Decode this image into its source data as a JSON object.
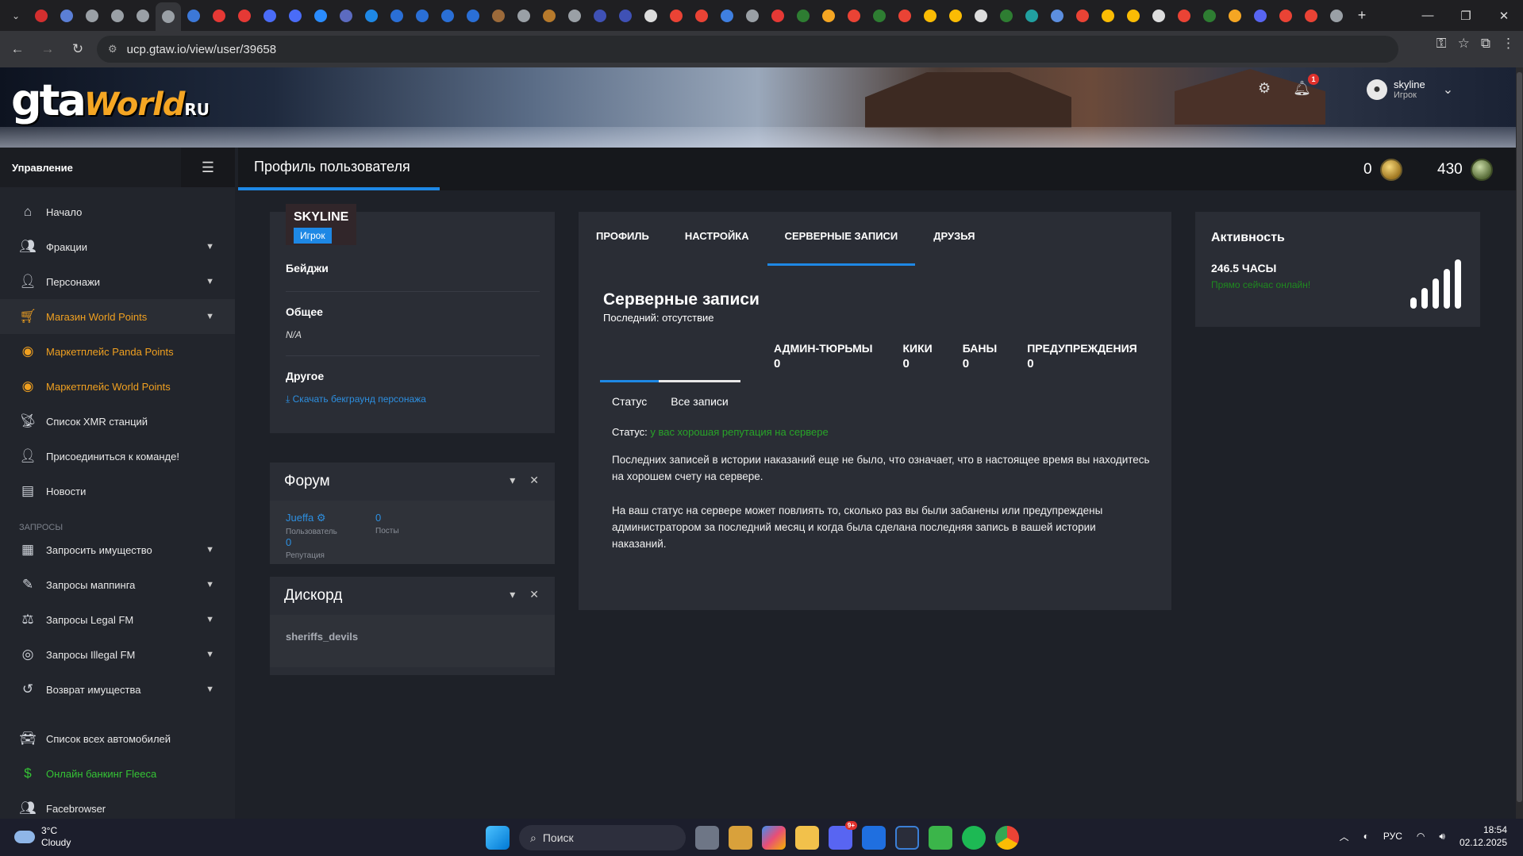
{
  "browser": {
    "url": "ucp.gtaw.io/view/user/39658",
    "tab_colors": [
      "#d32f2f",
      "#5b7fd6",
      "#9aa0a6",
      "#9aa0a6",
      "#9aa0a6",
      "#9aa0a6",
      "#3c78d8",
      "#e53935",
      "#e53935",
      "#4a6cf7",
      "#4a6cf7",
      "#2a8cff",
      "#5c6bc0",
      "#1e88e5",
      "#2a6fd6",
      "#2a6fd6",
      "#2a6fd6",
      "#2a6fd6",
      "#9c6a3a",
      "#9aa0a6",
      "#b77a2c",
      "#9aa0a6",
      "#3f51b5",
      "#3f51b5",
      "#ddd",
      "#ea4335",
      "#ea4335",
      "#3f7fe0",
      "#9aa0a6",
      "#e53935",
      "#2e7d32",
      "#f5a623",
      "#ea4335",
      "#2e7d32",
      "#ea4335",
      "#fbbc04",
      "#fbbc04",
      "#ddd",
      "#2e7d32",
      "#21a0a0",
      "#5c8fe0",
      "#ea4335",
      "#fbbc04",
      "#fbbc04",
      "#ddd",
      "#ea4335",
      "#2e7d32",
      "#f5a623",
      "#5865f2",
      "#ea4335",
      "#ea4335",
      "#9aa0a6"
    ]
  },
  "header": {
    "logo_main": "gta",
    "logo_script": "World",
    "logo_suffix": "RU",
    "notification_count": "1",
    "user_name": "skyline",
    "user_role": "Игрок"
  },
  "sidebar": {
    "title": "Управление",
    "items": [
      {
        "label": "Начало",
        "icon": "home-icon"
      },
      {
        "label": "Фракции",
        "icon": "group-icon"
      },
      {
        "label": "Персонажи",
        "icon": "person-icon"
      },
      {
        "label": "Магазин World Points",
        "icon": "cart-icon"
      },
      {
        "label": "Маркетплейс Panda Points",
        "icon": "coins-icon"
      },
      {
        "label": "Маркетплейс World Points",
        "icon": "coins-icon"
      },
      {
        "label": "Список XMR станций",
        "icon": "antenna-icon"
      },
      {
        "label": "Присоединиться к команде!",
        "icon": "person-icon"
      },
      {
        "label": "Новости",
        "icon": "newspaper-icon"
      }
    ],
    "section_requests": "Запросы",
    "request_items": [
      {
        "label": "Запросить имущество",
        "icon": "building-icon"
      },
      {
        "label": "Запросы маппинга",
        "icon": "brush-icon"
      },
      {
        "label": "Запросы Legal FM",
        "icon": "scales-icon"
      },
      {
        "label": "Запросы Illegal FM",
        "icon": "mask-icon"
      },
      {
        "label": "Возврат имущества",
        "icon": "undo-icon"
      }
    ],
    "bottom_items": [
      {
        "label": "Список всех автомобилей",
        "icon": "car-icon"
      },
      {
        "label": "Онлайн банкинг Fleeca",
        "icon": "money-icon"
      },
      {
        "label": "Facebrowser",
        "icon": "users-icon"
      }
    ]
  },
  "page": {
    "title": "Профиль пользователя",
    "currency_left": "0",
    "currency_right": "430"
  },
  "profile": {
    "name": "SKYLINE",
    "role": "Игрок",
    "badges_title": "Бейджи",
    "general_title": "Общее",
    "general_value": "N/A",
    "other_title": "Другое",
    "download_link": "Скачать бекграунд персонажа"
  },
  "forum": {
    "title": "Форум",
    "user": "Jueffa",
    "user_label": "Пользователь",
    "posts": "0",
    "posts_label": "Посты",
    "rep": "0",
    "rep_label": "Репутация"
  },
  "discord": {
    "title": "Дискорд",
    "name": "sheriffs_devils"
  },
  "records": {
    "tabs": [
      "ПРОФИЛЬ",
      "НАСТРОЙКА",
      "СЕРВЕРНЫЕ ЗАПИСИ",
      "ДРУЗЬЯ"
    ],
    "active_tab": 2,
    "title": "Серверные записи",
    "last": "Последний: отсутствие",
    "counts": [
      {
        "label": "АДМИН-ТЮРЬМЫ",
        "value": "0"
      },
      {
        "label": "КИКИ",
        "value": "0"
      },
      {
        "label": "БАНЫ",
        "value": "0"
      },
      {
        "label": "ПРЕДУПРЕЖДЕНИЯ",
        "value": "0"
      }
    ],
    "subtab_status": "Статус",
    "subtab_all": "Все записи",
    "status_label": "Статус:",
    "status_value": "у вас хорошая репутация на сервере",
    "p1": "Последних записей в истории наказаний еще не было, что означает, что в настоящее время вы находитесь на хорошем счету на сервере.",
    "p2": "На ваш статус на сервере может повлиять то, сколько раз вы были забанены или предупреждены администратором за последний месяц и когда была сделана последняя запись в вашей истории наказаний."
  },
  "activity": {
    "title": "Активность",
    "hours": "246.5 ЧАСЫ",
    "online": "Прямо сейчас онлайн!",
    "signal_level": 5
  },
  "taskbar": {
    "temp": "3°C",
    "weather": "Cloudy",
    "search": "Поиск",
    "lang": "РУС",
    "time": "18:54",
    "date": "02.12.2025",
    "discord_badge": "9+"
  }
}
